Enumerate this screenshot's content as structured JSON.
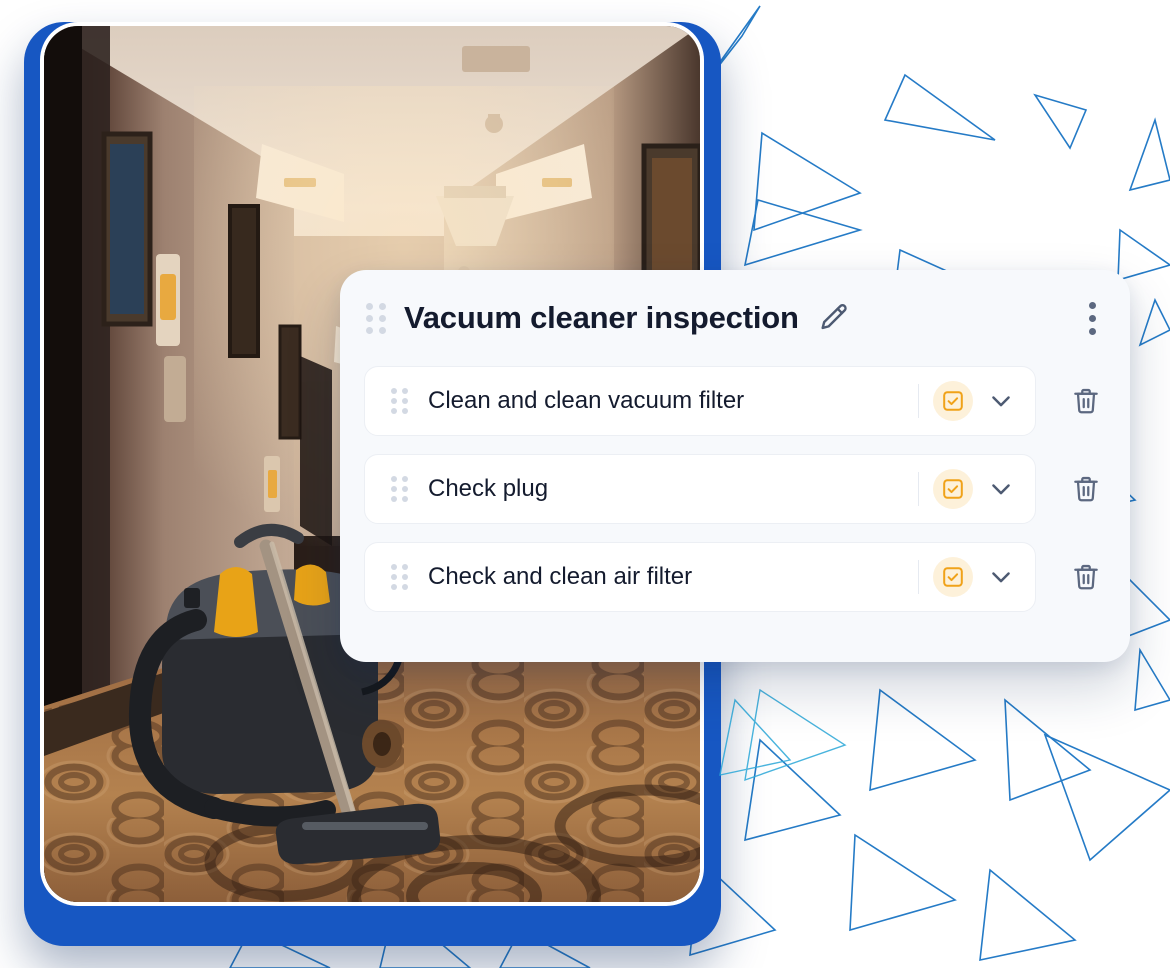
{
  "background": {
    "pattern": "scattered-outlined-triangles",
    "triangle_stroke": "#1a74c4",
    "page_bg": "#ffffff"
  },
  "blue_card": {
    "name": "blue-backdrop-card",
    "color": "#1757c2"
  },
  "photo": {
    "alt": "hotel corridor with canister vacuum cleaner on patterned carpet",
    "scene": "hotel-corridor-vacuum",
    "wall_color": "#b49a86",
    "ceiling_color": "#efe3d6",
    "carpet_color": "#a9754a",
    "vacuum_body_color": "#2a2c31",
    "vacuum_accent_color": "#e8a317"
  },
  "card": {
    "title": "Vacuum cleaner inspection",
    "drag_handle_icon": "drag-dots-icon",
    "edit_icon": "pencil-icon",
    "menu_icon": "more-vertical-icon",
    "bg_color": "#f7f9fc",
    "title_color": "#141b2e",
    "items": [
      {
        "label": "Clean and clean vacuum filter",
        "drag_handle_icon": "drag-dots-icon",
        "status_icon": "checkbox-checked-icon",
        "status_checked": true,
        "expand_icon": "chevron-down-icon",
        "delete_icon": "trash-icon"
      },
      {
        "label": "Check plug",
        "drag_handle_icon": "drag-dots-icon",
        "status_icon": "checkbox-checked-icon",
        "status_checked": true,
        "expand_icon": "chevron-down-icon",
        "delete_icon": "trash-icon"
      },
      {
        "label": "Check and clean air filter",
        "drag_handle_icon": "drag-dots-icon",
        "status_icon": "checkbox-checked-icon",
        "status_checked": true,
        "expand_icon": "chevron-down-icon",
        "delete_icon": "trash-icon"
      }
    ],
    "colors": {
      "checkbox_accent": "#f0a219",
      "checkbox_chip_bg": "#fdf1da",
      "chevron": "#4d5a72",
      "trash": "#5c6880",
      "row_bg": "#ffffff",
      "row_border": "#eceff4",
      "drag_dot": "#d3d9e3"
    }
  }
}
